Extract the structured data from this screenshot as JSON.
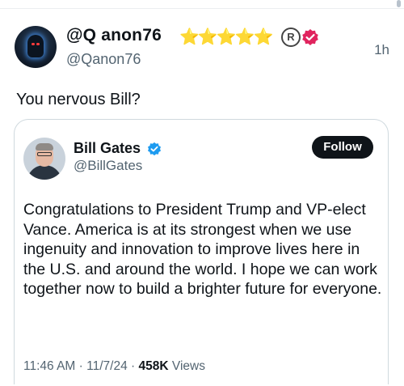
{
  "post": {
    "display_name": "@Q anon76",
    "name_decoration": "⭐⭐⭐⭐⭐",
    "registered_mark": "R",
    "handle": "@Qanon76",
    "time": "1h",
    "text": "You nervous Bill?"
  },
  "quoted_post": {
    "name": "Bill Gates",
    "handle": "@BillGates",
    "follow_label": "Follow",
    "text": "Congratulations to President Trump and VP-elect Vance. America is at its strongest when we use ingenuity and innovation to improve lives here in the U.S. and around the world. I hope we can work together now to build a brighter future for everyone.",
    "time": "11:46 AM",
    "date": "11/7/24",
    "separator": "·",
    "views_count": "458K",
    "views_label": "Views"
  },
  "colors": {
    "verified_pink": "#e0245e",
    "verified_blue": "#1d9bf0",
    "follow_bg": "#0f1419",
    "secondary_text": "#536471"
  },
  "icons": {
    "main_avatar": "hooded-figure-avatar",
    "quote_avatar": "bill-gates-avatar",
    "pink_badge": "verified-badge-pink-icon",
    "blue_badge": "verified-badge-blue-icon"
  }
}
